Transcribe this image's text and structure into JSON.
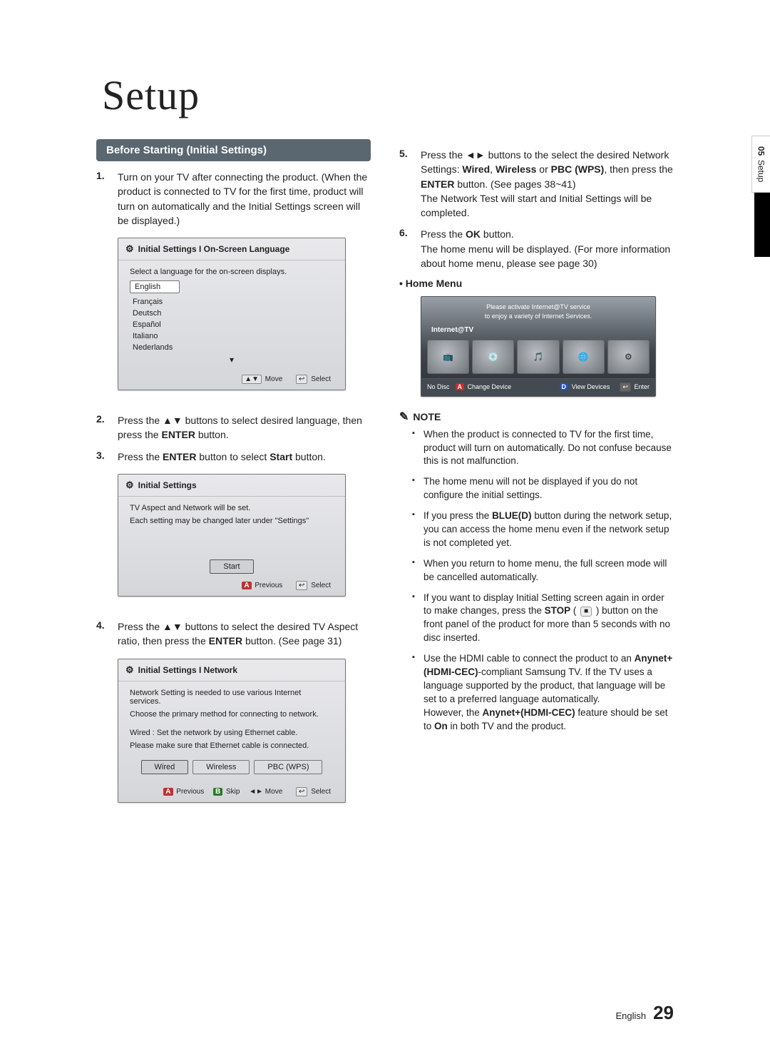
{
  "title": "Setup",
  "side_tab": {
    "chapter": "05",
    "label": "Setup"
  },
  "section_bar": "Before Starting (Initial Settings)",
  "left_steps": [
    {
      "n": "1.",
      "html": "Turn on your TV after connecting the product. (When the product is connected to TV for the first time, product will turn on automatically and the Initial Settings screen will be displayed.)"
    },
    {
      "n": "2.",
      "html": "Press the ▲▼ buttons to select desired language, then press the <b>ENTER</b> button."
    },
    {
      "n": "3.",
      "html": "Press the <b>ENTER</b> button to select <b>Start</b> button."
    },
    {
      "n": "4.",
      "html": "Press the ▲▼ buttons to select the desired TV Aspect ratio, then press the <b>ENTER</b> button. (See page 31)"
    }
  ],
  "right_steps": [
    {
      "n": "5.",
      "html": "Press the ◄► buttons to the select the desired Network Settings: <b>Wired</b>, <b>Wireless</b> or <b>PBC (WPS)</b>, then press the <b>ENTER</b> button. (See pages 38~41)<br>The Network Test will start and Initial Settings will be completed."
    },
    {
      "n": "6.",
      "html": "Press the <b>OK</b> button.<br>The home menu will be displayed. (For more information about home menu, please see page 30)"
    }
  ],
  "home_menu_label": "• Home Menu",
  "ui_lang": {
    "title": "Initial Settings I On-Screen Language",
    "prompt": "Select a language for the on-screen displays.",
    "selected": "English",
    "items": [
      "Français",
      "Deutsch",
      "Español",
      "Italiano",
      "Nederlands"
    ],
    "ftr": {
      "move_sym": "▲▼",
      "move": "Move",
      "select_sym": "↩",
      "select": "Select"
    }
  },
  "ui_start": {
    "title": "Initial Settings",
    "line1": "TV Aspect and Network will be set.",
    "line2": "Each setting may be changed later under \"Settings\"",
    "btn": "Start",
    "ftr": {
      "a": "A",
      "prev": "Previous",
      "select_sym": "↩",
      "select": "Select"
    }
  },
  "ui_net": {
    "title": "Initial Settings I Network",
    "line1": "Network Setting is needed to use various Internet services.",
    "line2": "Choose the primary method for connecting to network.",
    "line3": "Wired : Set the network by using Ethernet cable.",
    "line4": "Please make sure that Ethernet cable is connected.",
    "btns": [
      "Wired",
      "Wireless",
      "PBC (WPS)"
    ],
    "ftr": {
      "a": "A",
      "prev": "Previous",
      "b": "B",
      "skip": "Skip",
      "move_sym": "◄►",
      "move": "Move",
      "select_sym": "↩",
      "select": "Select"
    }
  },
  "home_box": {
    "top1": "Please activate Internet@TV service",
    "top2": "to enjoy a variety of Internet Services.",
    "label": "Internet@TV",
    "tile_icons": [
      "📺",
      "💿",
      "🎵",
      "🌐",
      "⚙"
    ],
    "ftr": {
      "nodisc": "No Disc",
      "a": "A",
      "change": "Change Device",
      "d": "D",
      "view": "View Devices",
      "enter_sym": "↩",
      "enter": "Enter"
    }
  },
  "note_label": "NOTE",
  "notes": [
    "When the product is connected to TV for the first time, product will turn on automatically. Do not confuse because this is not malfunction.",
    "The home menu will not be displayed if you do not configure the initial settings.",
    "If you press the <b>BLUE(D)</b> button during the network setup, you can access the home menu even if the network setup is not completed yet.",
    "When you return to home menu, the full screen mode will be cancelled automatically.",
    "If you want to display Initial Setting screen again in order to make changes, press the <b>STOP</b> ( <span class=\"stop-btn\">■</span> ) button on the front panel of the product for more than 5 seconds with no disc inserted.",
    "Use the HDMI cable to connect the product to an <b>Anynet+(HDMI-CEC)</b>-compliant Samsung TV. If the TV uses a language supported by the product, that language will be set to a preferred language automatically.<br>However, the <b>Anynet+(HDMI-CEC)</b> feature should be set to <b>On</b> in both TV and the product."
  ],
  "footer": {
    "lang": "English",
    "page": "29"
  }
}
